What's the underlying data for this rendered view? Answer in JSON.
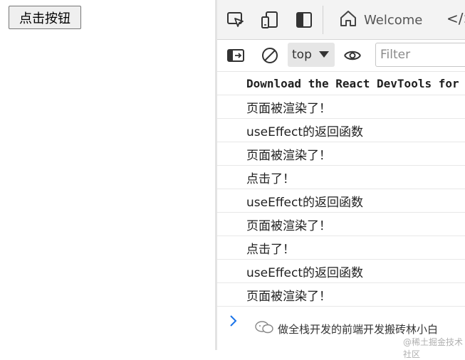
{
  "page": {
    "button_label": "点击按钮"
  },
  "devtools": {
    "tabs": {
      "welcome_label": "Welcome",
      "sources_glyph": "</>"
    },
    "toolbar": {
      "context_value": "top",
      "filter_placeholder": "Filter"
    },
    "console": {
      "messages": [
        "Download the React DevTools for",
        "页面被渲染了！",
        "useEffect的返回函数",
        "页面被渲染了！",
        "点击了！",
        "useEffect的返回函数",
        "页面被渲染了！",
        "点击了！",
        "useEffect的返回函数",
        "页面被渲染了！"
      ]
    }
  },
  "watermark": {
    "text": "做全栈开发的前端开发搬砖林小白",
    "sub": "@稀土掘金技术社区"
  },
  "icons": {
    "inspect": "inspect-element-icon",
    "device": "device-toolbar-icon",
    "drawer": "toggle-drawer-icon",
    "home": "home-icon",
    "sidebar": "console-sidebar-icon",
    "clear": "clear-console-icon",
    "eye": "live-expression-icon",
    "chevron": "chevron-right-icon",
    "wechat": "wechat-icon"
  },
  "colors": {
    "toolbar_bg": "#f3f3f3",
    "prompt_blue": "#1a73e8"
  }
}
